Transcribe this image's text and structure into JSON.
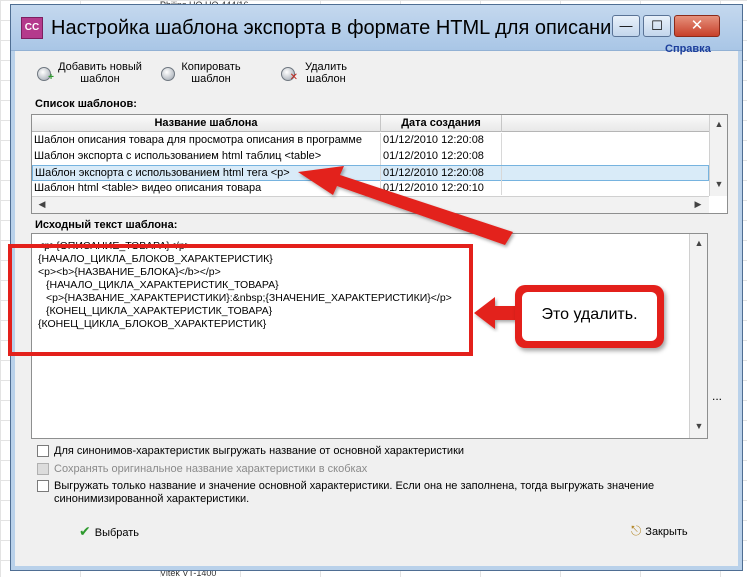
{
  "background": {
    "peek_top": "Philips HQ HQ 444/16",
    "peek_bottom": "Vitek VT-1400"
  },
  "window": {
    "icon_text": "CC",
    "title": "Настройка шаблона экспорта в формате HTML для описания т...",
    "help_link": "Справка",
    "controls": {
      "minimize": "—",
      "maximize": "☐",
      "close": "✕"
    }
  },
  "toolbar": {
    "add_label": "Добавить новый шаблон",
    "copy_label": "Копировать шаблон",
    "delete_label": "Удалить шаблон"
  },
  "templates": {
    "section_label": "Список шаблонов:",
    "columns": [
      "Название шаблона",
      "Дата создания"
    ],
    "rows": [
      {
        "name": "Шаблон описания товара для просмотра описания в программе",
        "date": "01/12/2010 12:20:08"
      },
      {
        "name": "Шаблон экспорта с использованием html таблиц <table>",
        "date": "01/12/2010 12:20:08"
      },
      {
        "name": "Шаблон экспорта с использованием html тега <p>",
        "date": "01/12/2010 12:20:08"
      },
      {
        "name": "Шаблон html <table> видео описания товара",
        "date": "01/12/2010 12:20:10"
      }
    ],
    "selected_index": 2
  },
  "source": {
    "section_label": "Исходный текст шаблона:",
    "lines": [
      "<p>{ОПИСАНИЕ_ТОВАРА}</p>",
      "{НАЧАЛО_ЦИКЛА_БЛОКОВ_ХАРАКТЕРИСТИК}",
      "<p><b>{НАЗВАНИЕ_БЛОКА}</b></p>",
      "  {НАЧАЛО_ЦИКЛА_ХАРАКТЕРИСТИК_ТОВАРА}",
      "  <p>{НАЗВАНИЕ_ХАРАКТЕРИСТИКИ}:&nbsp;{ЗНАЧЕНИЕ_ХАРАКТЕРИСТИКИ}</p>",
      "  {КОНЕЦ_ЦИКЛА_ХАРАКТЕРИСТИК_ТОВАРА}",
      "{КОНЕЦ_ЦИКЛА_БЛОКОВ_ХАРАКТЕРИСТИК}"
    ],
    "ellipsis": "..."
  },
  "options": {
    "synonyms": "Для синонимов-характеристик выгружать название от основной характеристики",
    "keep_original": "Сохранять оригинальное название характеристики в скобках",
    "main_only_line1": "Выгружать только название и значение основной характеристики. Если она не заполнена, тогда выгружать значение",
    "main_only_line2": "синонимизированной характеристики."
  },
  "buttons": {
    "select": "Выбрать",
    "close": "Закрыть"
  },
  "annotation": {
    "callout": "Это удалить."
  },
  "colors": {
    "annotation_red": "#e3201b",
    "help_link": "#1d3f9c",
    "selection": "#d9ebf8"
  }
}
